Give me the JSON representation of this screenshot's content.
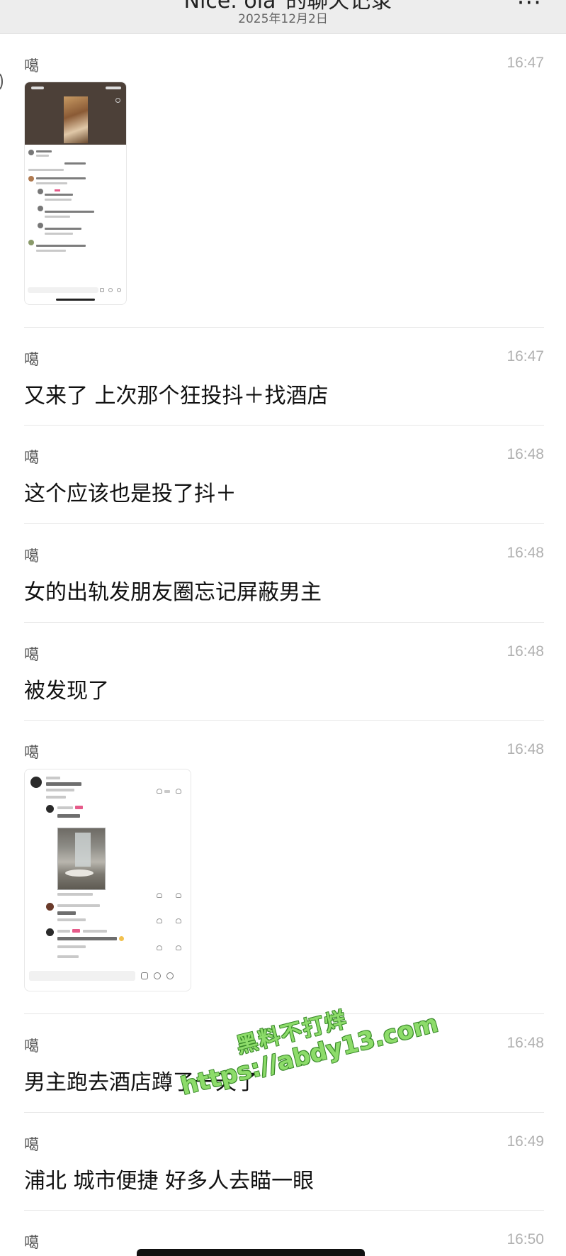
{
  "header": {
    "title": "\"Nice. ola\"的聊天记录",
    "date": "2025年12月2日",
    "more_label": "···"
  },
  "messages": [
    {
      "sender": "噶",
      "time": "16:47",
      "type": "image",
      "image": "phone-screenshot-video-comments"
    },
    {
      "sender": "噶",
      "time": "16:47",
      "type": "text",
      "text": "又来了 上次那个狂投抖＋找酒店"
    },
    {
      "sender": "噶",
      "time": "16:48",
      "type": "text",
      "text": "这个应该也是投了抖＋"
    },
    {
      "sender": "噶",
      "time": "16:48",
      "type": "text",
      "text": "女的出轨发朋友圈忘记屏蔽男主"
    },
    {
      "sender": "噶",
      "time": "16:48",
      "type": "text",
      "text": "被发现了"
    },
    {
      "sender": "噶",
      "time": "16:48",
      "type": "image",
      "image": "comment-thread-screenshot"
    },
    {
      "sender": "噶",
      "time": "16:48",
      "type": "text",
      "text": "男主跑去酒店蹲了一天了"
    },
    {
      "sender": "噶",
      "time": "16:49",
      "type": "text",
      "text": "浦北 城市便捷 好多人去瞄一眼"
    },
    {
      "sender": "噶",
      "time": "16:50",
      "type": "text",
      "text": ""
    }
  ],
  "watermark": {
    "line1": "黑料不打烊",
    "line2": "https://abdy13.com"
  },
  "icons": {
    "more": "more-dots-icon",
    "search": "search-icon",
    "heart": "heart-icon"
  },
  "colors": {
    "header_bg": "#ededed",
    "watermark": "#8ddc6a",
    "time_gray": "#b0b0b0"
  }
}
